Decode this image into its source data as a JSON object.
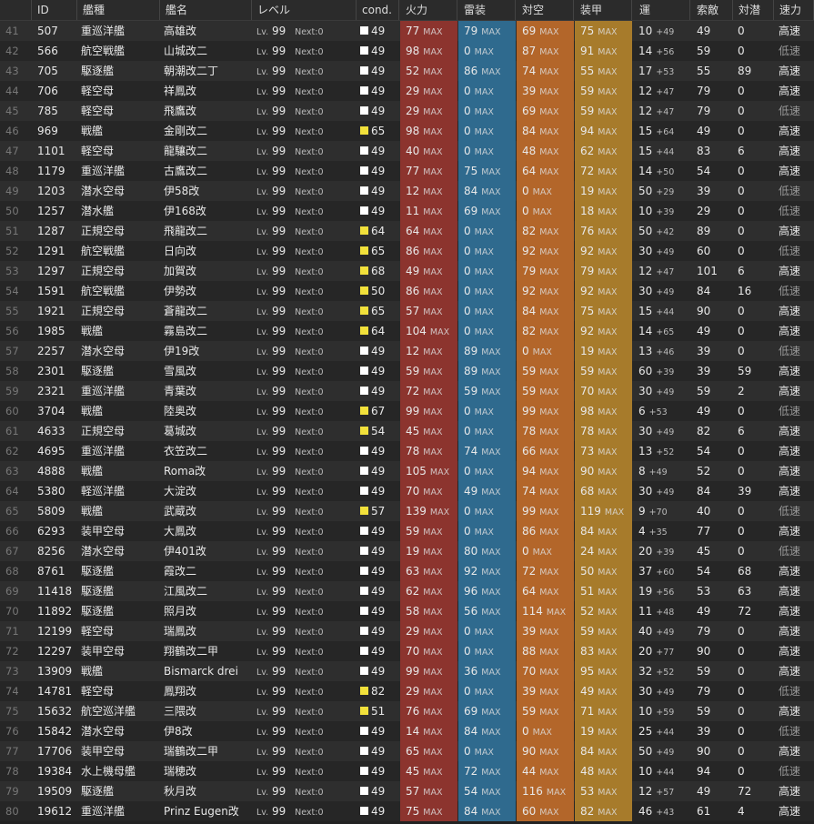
{
  "header": {
    "no": "",
    "id": "ID",
    "type": "艦種",
    "name": "艦名",
    "level": "レベル",
    "cond": "cond.",
    "firepower": "火力",
    "torpedo": "雷装",
    "antiair": "対空",
    "armor": "装甲",
    "luck": "運",
    "los": "索敵",
    "asw": "対潜",
    "speed": "速力"
  },
  "labels": {
    "lv": "Lv.",
    "next": "Next:0",
    "max": "MAX"
  },
  "colors": {
    "cond_white": "#ffffff",
    "cond_yellow": "#f2e13b",
    "firepower_bg": "#8c342e",
    "torpedo_bg": "#2f6a8e",
    "antiair_bg": "#b3662a",
    "armor_bg": "#a77b2b"
  },
  "rows": [
    {
      "no": "41",
      "id": "507",
      "type": "重巡洋艦",
      "name": "高雄改",
      "lv": "99",
      "cond": "49",
      "cc": "w",
      "fp": "77",
      "tp": "79",
      "aa": "69",
      "ar": "75",
      "luck": "10",
      "lp": "+49",
      "los": "49",
      "asw": "0",
      "speed": "高速"
    },
    {
      "no": "42",
      "id": "566",
      "type": "航空戦艦",
      "name": "山城改二",
      "lv": "99",
      "cond": "49",
      "cc": "w",
      "fp": "98",
      "tp": "0",
      "aa": "87",
      "ar": "91",
      "luck": "14",
      "lp": "+56",
      "los": "59",
      "asw": "0",
      "speed": "低速"
    },
    {
      "no": "43",
      "id": "705",
      "type": "駆逐艦",
      "name": "朝潮改二丁",
      "lv": "99",
      "cond": "49",
      "cc": "w",
      "fp": "52",
      "tp": "86",
      "aa": "74",
      "ar": "55",
      "luck": "17",
      "lp": "+53",
      "los": "55",
      "asw": "89",
      "speed": "高速"
    },
    {
      "no": "44",
      "id": "706",
      "type": "軽空母",
      "name": "祥鳳改",
      "lv": "99",
      "cond": "49",
      "cc": "w",
      "fp": "29",
      "tp": "0",
      "aa": "39",
      "ar": "59",
      "luck": "12",
      "lp": "+47",
      "los": "79",
      "asw": "0",
      "speed": "高速"
    },
    {
      "no": "45",
      "id": "785",
      "type": "軽空母",
      "name": "飛鷹改",
      "lv": "99",
      "cond": "49",
      "cc": "w",
      "fp": "29",
      "tp": "0",
      "aa": "69",
      "ar": "59",
      "luck": "12",
      "lp": "+47",
      "los": "79",
      "asw": "0",
      "speed": "低速"
    },
    {
      "no": "46",
      "id": "969",
      "type": "戦艦",
      "name": "金剛改二",
      "lv": "99",
      "cond": "65",
      "cc": "y",
      "fp": "98",
      "tp": "0",
      "aa": "84",
      "ar": "94",
      "luck": "15",
      "lp": "+64",
      "los": "49",
      "asw": "0",
      "speed": "高速"
    },
    {
      "no": "47",
      "id": "1101",
      "type": "軽空母",
      "name": "龍驤改二",
      "lv": "99",
      "cond": "49",
      "cc": "w",
      "fp": "40",
      "tp": "0",
      "aa": "48",
      "ar": "62",
      "luck": "15",
      "lp": "+44",
      "los": "83",
      "asw": "6",
      "speed": "高速"
    },
    {
      "no": "48",
      "id": "1179",
      "type": "重巡洋艦",
      "name": "古鷹改二",
      "lv": "99",
      "cond": "49",
      "cc": "w",
      "fp": "77",
      "tp": "75",
      "aa": "64",
      "ar": "72",
      "luck": "14",
      "lp": "+50",
      "los": "54",
      "asw": "0",
      "speed": "高速"
    },
    {
      "no": "49",
      "id": "1203",
      "type": "潜水空母",
      "name": "伊58改",
      "lv": "99",
      "cond": "49",
      "cc": "w",
      "fp": "12",
      "tp": "84",
      "aa": "0",
      "ar": "19",
      "luck": "50",
      "lp": "+29",
      "los": "39",
      "asw": "0",
      "speed": "低速"
    },
    {
      "no": "50",
      "id": "1257",
      "type": "潜水艦",
      "name": "伊168改",
      "lv": "99",
      "cond": "49",
      "cc": "w",
      "fp": "11",
      "tp": "69",
      "aa": "0",
      "ar": "18",
      "luck": "10",
      "lp": "+39",
      "los": "29",
      "asw": "0",
      "speed": "低速"
    },
    {
      "no": "51",
      "id": "1287",
      "type": "正規空母",
      "name": "飛龍改二",
      "lv": "99",
      "cond": "64",
      "cc": "y",
      "fp": "64",
      "tp": "0",
      "aa": "82",
      "ar": "76",
      "luck": "50",
      "lp": "+42",
      "los": "89",
      "asw": "0",
      "speed": "高速"
    },
    {
      "no": "52",
      "id": "1291",
      "type": "航空戦艦",
      "name": "日向改",
      "lv": "99",
      "cond": "65",
      "cc": "y",
      "fp": "86",
      "tp": "0",
      "aa": "92",
      "ar": "92",
      "luck": "30",
      "lp": "+49",
      "los": "60",
      "asw": "0",
      "speed": "低速"
    },
    {
      "no": "53",
      "id": "1297",
      "type": "正規空母",
      "name": "加賀改",
      "lv": "99",
      "cond": "68",
      "cc": "y",
      "fp": "49",
      "tp": "0",
      "aa": "79",
      "ar": "79",
      "luck": "12",
      "lp": "+47",
      "los": "101",
      "asw": "6",
      "speed": "高速"
    },
    {
      "no": "54",
      "id": "1591",
      "type": "航空戦艦",
      "name": "伊勢改",
      "lv": "99",
      "cond": "50",
      "cc": "y",
      "fp": "86",
      "tp": "0",
      "aa": "92",
      "ar": "92",
      "luck": "30",
      "lp": "+49",
      "los": "84",
      "asw": "16",
      "speed": "低速"
    },
    {
      "no": "55",
      "id": "1921",
      "type": "正規空母",
      "name": "蒼龍改二",
      "lv": "99",
      "cond": "65",
      "cc": "y",
      "fp": "57",
      "tp": "0",
      "aa": "84",
      "ar": "75",
      "luck": "15",
      "lp": "+44",
      "los": "90",
      "asw": "0",
      "speed": "高速"
    },
    {
      "no": "56",
      "id": "1985",
      "type": "戦艦",
      "name": "霧島改二",
      "lv": "99",
      "cond": "64",
      "cc": "y",
      "fp": "104",
      "tp": "0",
      "aa": "82",
      "ar": "92",
      "luck": "14",
      "lp": "+65",
      "los": "49",
      "asw": "0",
      "speed": "高速"
    },
    {
      "no": "57",
      "id": "2257",
      "type": "潜水空母",
      "name": "伊19改",
      "lv": "99",
      "cond": "49",
      "cc": "w",
      "fp": "12",
      "tp": "89",
      "aa": "0",
      "ar": "19",
      "luck": "13",
      "lp": "+46",
      "los": "39",
      "asw": "0",
      "speed": "低速"
    },
    {
      "no": "58",
      "id": "2301",
      "type": "駆逐艦",
      "name": "雪風改",
      "lv": "99",
      "cond": "49",
      "cc": "w",
      "fp": "59",
      "tp": "89",
      "aa": "59",
      "ar": "59",
      "luck": "60",
      "lp": "+39",
      "los": "39",
      "asw": "59",
      "speed": "高速"
    },
    {
      "no": "59",
      "id": "2321",
      "type": "重巡洋艦",
      "name": "青葉改",
      "lv": "99",
      "cond": "49",
      "cc": "w",
      "fp": "72",
      "tp": "59",
      "aa": "59",
      "ar": "70",
      "luck": "30",
      "lp": "+49",
      "los": "59",
      "asw": "2",
      "speed": "高速"
    },
    {
      "no": "60",
      "id": "3704",
      "type": "戦艦",
      "name": "陸奥改",
      "lv": "99",
      "cond": "67",
      "cc": "y",
      "fp": "99",
      "tp": "0",
      "aa": "99",
      "ar": "98",
      "luck": "6",
      "lp": "+53",
      "los": "49",
      "asw": "0",
      "speed": "低速"
    },
    {
      "no": "61",
      "id": "4633",
      "type": "正規空母",
      "name": "葛城改",
      "lv": "99",
      "cond": "54",
      "cc": "y",
      "fp": "45",
      "tp": "0",
      "aa": "78",
      "ar": "78",
      "luck": "30",
      "lp": "+49",
      "los": "82",
      "asw": "6",
      "speed": "高速"
    },
    {
      "no": "62",
      "id": "4695",
      "type": "重巡洋艦",
      "name": "衣笠改二",
      "lv": "99",
      "cond": "49",
      "cc": "w",
      "fp": "78",
      "tp": "74",
      "aa": "66",
      "ar": "73",
      "luck": "13",
      "lp": "+52",
      "los": "54",
      "asw": "0",
      "speed": "高速"
    },
    {
      "no": "63",
      "id": "4888",
      "type": "戦艦",
      "name": "Roma改",
      "lv": "99",
      "cond": "49",
      "cc": "w",
      "fp": "105",
      "tp": "0",
      "aa": "94",
      "ar": "90",
      "luck": "8",
      "lp": "+49",
      "los": "52",
      "asw": "0",
      "speed": "高速"
    },
    {
      "no": "64",
      "id": "5380",
      "type": "軽巡洋艦",
      "name": "大淀改",
      "lv": "99",
      "cond": "49",
      "cc": "w",
      "fp": "70",
      "tp": "49",
      "aa": "74",
      "ar": "68",
      "luck": "30",
      "lp": "+49",
      "los": "84",
      "asw": "39",
      "speed": "高速"
    },
    {
      "no": "65",
      "id": "5809",
      "type": "戦艦",
      "name": "武蔵改",
      "lv": "99",
      "cond": "57",
      "cc": "y",
      "fp": "139",
      "tp": "0",
      "aa": "99",
      "ar": "119",
      "luck": "9",
      "lp": "+70",
      "los": "40",
      "asw": "0",
      "speed": "低速"
    },
    {
      "no": "66",
      "id": "6293",
      "type": "装甲空母",
      "name": "大鳳改",
      "lv": "99",
      "cond": "49",
      "cc": "w",
      "fp": "59",
      "tp": "0",
      "aa": "86",
      "ar": "84",
      "luck": "4",
      "lp": "+35",
      "los": "77",
      "asw": "0",
      "speed": "高速"
    },
    {
      "no": "67",
      "id": "8256",
      "type": "潜水空母",
      "name": "伊401改",
      "lv": "99",
      "cond": "49",
      "cc": "w",
      "fp": "19",
      "tp": "80",
      "aa": "0",
      "ar": "24",
      "luck": "20",
      "lp": "+39",
      "los": "45",
      "asw": "0",
      "speed": "低速"
    },
    {
      "no": "68",
      "id": "8761",
      "type": "駆逐艦",
      "name": "霞改二",
      "lv": "99",
      "cond": "49",
      "cc": "w",
      "fp": "63",
      "tp": "92",
      "aa": "72",
      "ar": "50",
      "luck": "37",
      "lp": "+60",
      "los": "54",
      "asw": "68",
      "speed": "高速"
    },
    {
      "no": "69",
      "id": "11418",
      "type": "駆逐艦",
      "name": "江風改二",
      "lv": "99",
      "cond": "49",
      "cc": "w",
      "fp": "62",
      "tp": "96",
      "aa": "64",
      "ar": "51",
      "luck": "19",
      "lp": "+56",
      "los": "53",
      "asw": "63",
      "speed": "高速"
    },
    {
      "no": "70",
      "id": "11892",
      "type": "駆逐艦",
      "name": "照月改",
      "lv": "99",
      "cond": "49",
      "cc": "w",
      "fp": "58",
      "tp": "56",
      "aa": "114",
      "ar": "52",
      "luck": "11",
      "lp": "+48",
      "los": "49",
      "asw": "72",
      "speed": "高速"
    },
    {
      "no": "71",
      "id": "12199",
      "type": "軽空母",
      "name": "瑞鳳改",
      "lv": "99",
      "cond": "49",
      "cc": "w",
      "fp": "29",
      "tp": "0",
      "aa": "39",
      "ar": "59",
      "luck": "40",
      "lp": "+49",
      "los": "79",
      "asw": "0",
      "speed": "高速"
    },
    {
      "no": "72",
      "id": "12297",
      "type": "装甲空母",
      "name": "翔鶴改二甲",
      "lv": "99",
      "cond": "49",
      "cc": "w",
      "fp": "70",
      "tp": "0",
      "aa": "88",
      "ar": "83",
      "luck": "20",
      "lp": "+77",
      "los": "90",
      "asw": "0",
      "speed": "高速"
    },
    {
      "no": "73",
      "id": "13909",
      "type": "戦艦",
      "name": "Bismarck drei",
      "lv": "99",
      "cond": "49",
      "cc": "w",
      "fp": "99",
      "tp": "36",
      "aa": "70",
      "ar": "95",
      "luck": "32",
      "lp": "+52",
      "los": "59",
      "asw": "0",
      "speed": "高速"
    },
    {
      "no": "74",
      "id": "14781",
      "type": "軽空母",
      "name": "鳳翔改",
      "lv": "99",
      "cond": "82",
      "cc": "y",
      "fp": "29",
      "tp": "0",
      "aa": "39",
      "ar": "49",
      "luck": "30",
      "lp": "+49",
      "los": "79",
      "asw": "0",
      "speed": "低速"
    },
    {
      "no": "75",
      "id": "15632",
      "type": "航空巡洋艦",
      "name": "三隈改",
      "lv": "99",
      "cond": "51",
      "cc": "y",
      "fp": "76",
      "tp": "69",
      "aa": "59",
      "ar": "71",
      "luck": "10",
      "lp": "+59",
      "los": "59",
      "asw": "0",
      "speed": "高速"
    },
    {
      "no": "76",
      "id": "15842",
      "type": "潜水空母",
      "name": "伊8改",
      "lv": "99",
      "cond": "49",
      "cc": "w",
      "fp": "14",
      "tp": "84",
      "aa": "0",
      "ar": "19",
      "luck": "25",
      "lp": "+44",
      "los": "39",
      "asw": "0",
      "speed": "低速"
    },
    {
      "no": "77",
      "id": "17706",
      "type": "装甲空母",
      "name": "瑞鶴改二甲",
      "lv": "99",
      "cond": "49",
      "cc": "w",
      "fp": "65",
      "tp": "0",
      "aa": "90",
      "ar": "84",
      "luck": "50",
      "lp": "+49",
      "los": "90",
      "asw": "0",
      "speed": "高速"
    },
    {
      "no": "78",
      "id": "19384",
      "type": "水上機母艦",
      "name": "瑞穂改",
      "lv": "99",
      "cond": "49",
      "cc": "w",
      "fp": "45",
      "tp": "72",
      "aa": "44",
      "ar": "48",
      "luck": "10",
      "lp": "+44",
      "los": "94",
      "asw": "0",
      "speed": "低速"
    },
    {
      "no": "79",
      "id": "19509",
      "type": "駆逐艦",
      "name": "秋月改",
      "lv": "99",
      "cond": "49",
      "cc": "w",
      "fp": "57",
      "tp": "54",
      "aa": "116",
      "ar": "53",
      "luck": "12",
      "lp": "+57",
      "los": "49",
      "asw": "72",
      "speed": "高速"
    },
    {
      "no": "80",
      "id": "19612",
      "type": "重巡洋艦",
      "name": "Prinz Eugen改",
      "lv": "99",
      "cond": "49",
      "cc": "w",
      "fp": "75",
      "tp": "84",
      "aa": "60",
      "ar": "82",
      "luck": "46",
      "lp": "+43",
      "los": "61",
      "asw": "4",
      "speed": "高速"
    }
  ]
}
